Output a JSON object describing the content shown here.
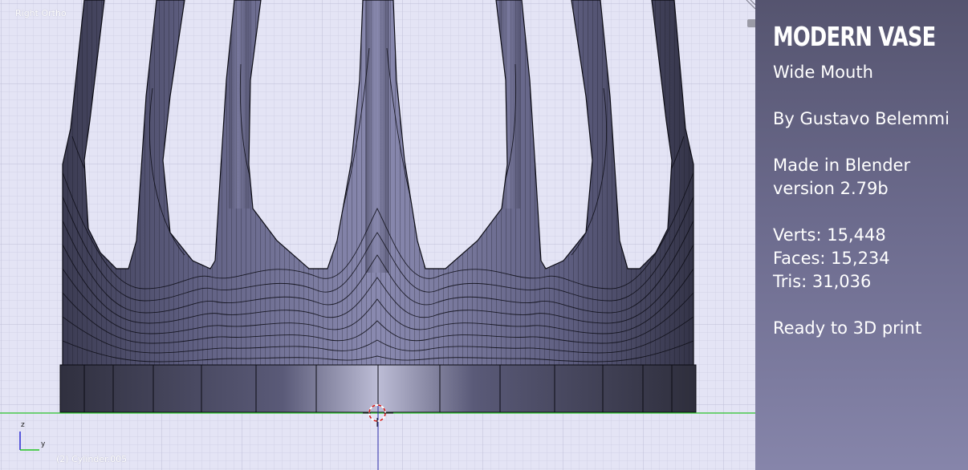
{
  "viewport": {
    "view_label": "Right Ortho",
    "object_label": "(2) Cylinder.005",
    "axis_z": "z",
    "axis_y": "y",
    "colors": {
      "background": "#e4e4f5",
      "grid_minor": "#d2d2e6",
      "grid_major": "#bebed8",
      "floor_line": "#2fc82f",
      "z_axis": "#2a2aa8",
      "mesh": "#5b5b7c",
      "wire": "#0c0c14"
    }
  },
  "panel": {
    "title": "MODERN VASE",
    "subtitle": "Wide Mouth",
    "author": "By Gustavo Belemmi",
    "made_in": "Made in Blender",
    "version": "version 2.79b",
    "verts": "Verts: 15,448",
    "faces": "Faces: 15,234",
    "tris": "Tris: 31,036",
    "ready": "Ready to 3D print"
  }
}
